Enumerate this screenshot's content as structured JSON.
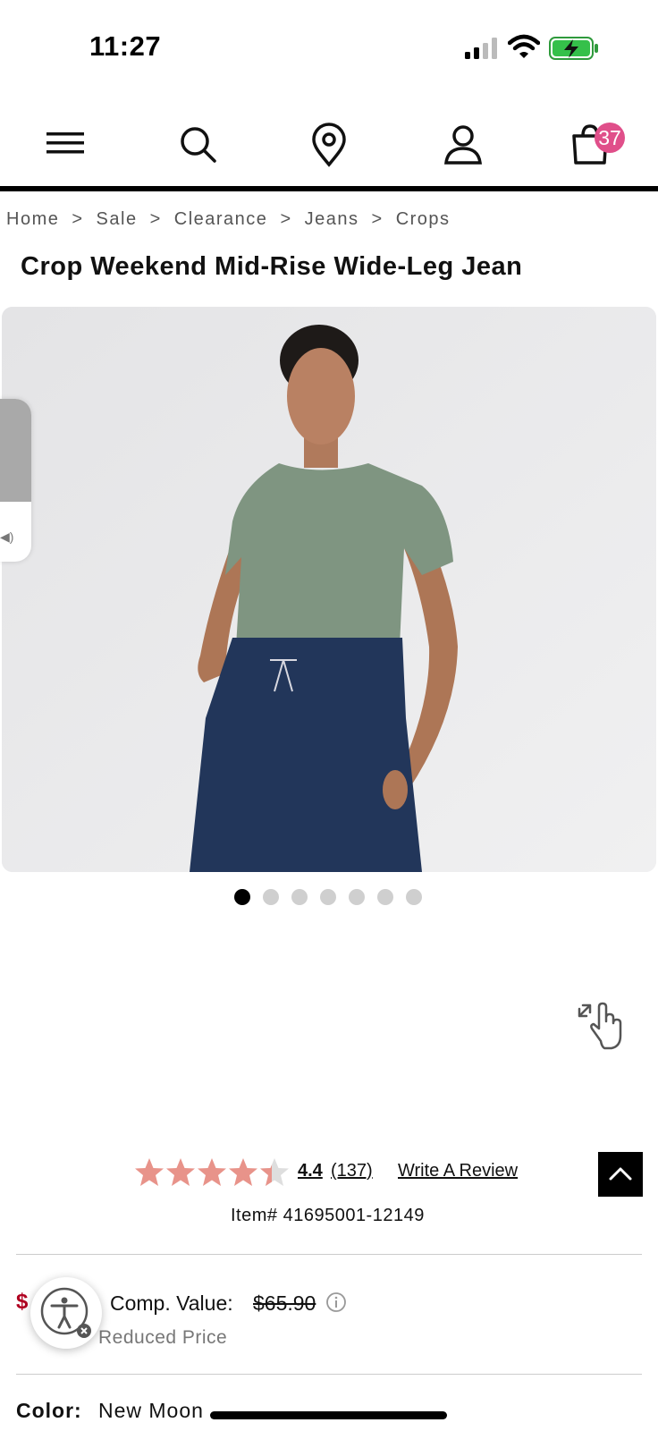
{
  "status_bar": {
    "time": "11:27"
  },
  "nav": {
    "icons": [
      "menu-icon",
      "search-icon",
      "location-pin-icon",
      "account-icon",
      "cart-icon"
    ],
    "cart_count": "37"
  },
  "breadcrumb": [
    "Home",
    ">",
    "Sale",
    ">",
    "Clearance",
    ">",
    "Jeans",
    ">",
    "Crops"
  ],
  "product": {
    "title": "Crop Weekend Mid-Rise Wide-Leg Jean",
    "image_count": 7,
    "active_image_index": 0,
    "rating": "4.4",
    "review_count": "(137)",
    "rating_stars_out_of_5": 4.4,
    "write_review": "Write A Review",
    "item_number": "Item# 41695001-12149",
    "price_partial": "$",
    "comp_value_label": "Comp. Value:",
    "comp_value": "$65.90",
    "reduced_label": "Reduced Price",
    "color_label": "Color:",
    "color_value": "New Moon"
  },
  "colors": {
    "accent_badge": "#e04f8a",
    "star": "#e8938a",
    "price_red": "#b00020",
    "shirt": "#7f9581",
    "jeans": "#22365a"
  },
  "volume_level": 0.37
}
